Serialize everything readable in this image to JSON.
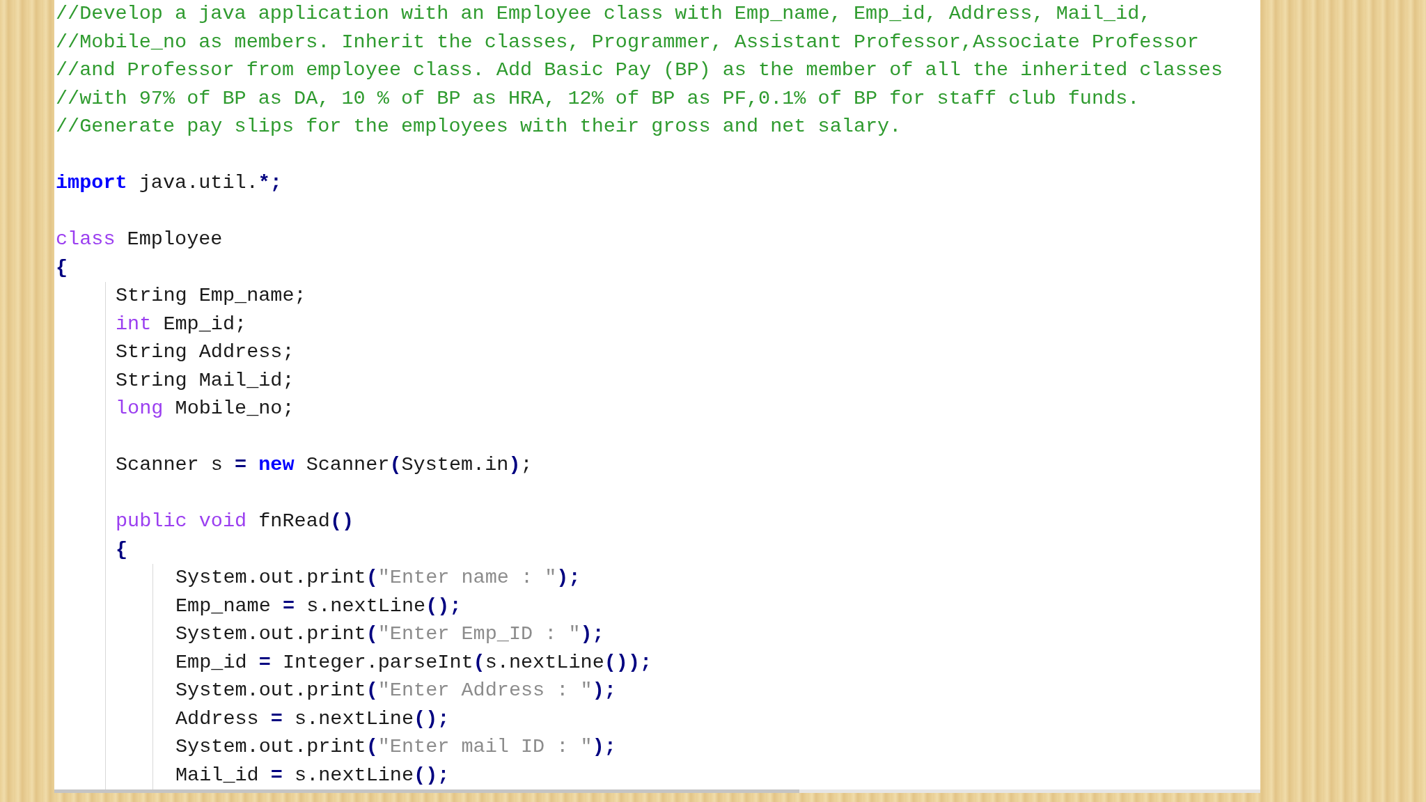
{
  "editor": {
    "lines": [
      {
        "kind": "code",
        "tokens": [
          {
            "kind": "comment",
            "text": "//Develop a java application with an Employee class with Emp_name, Emp_id, Address, Mail_id,"
          }
        ]
      },
      {
        "kind": "code",
        "tokens": [
          {
            "kind": "comment",
            "text": "//Mobile_no as members. Inherit the classes, Programmer, Assistant Professor,Associate Professor"
          }
        ]
      },
      {
        "kind": "code",
        "tokens": [
          {
            "kind": "comment",
            "text": "//and Professor from employee class. Add Basic Pay (BP) as the member of all the inherited classes"
          }
        ]
      },
      {
        "kind": "code",
        "tokens": [
          {
            "kind": "comment",
            "text": "//with 97% of BP as DA, 10 % of BP as HRA, 12% of BP as PF,0.1% of BP for staff club funds."
          }
        ]
      },
      {
        "kind": "code",
        "tokens": [
          {
            "kind": "comment",
            "text": "//Generate pay slips for the employees with their gross and net salary."
          }
        ]
      },
      {
        "kind": "blank"
      },
      {
        "kind": "code",
        "tokens": [
          {
            "kind": "keyword",
            "text": "import"
          },
          {
            "kind": "plain",
            "text": " java.util."
          },
          {
            "kind": "operator",
            "text": "*;"
          }
        ]
      },
      {
        "kind": "blank"
      },
      {
        "kind": "code",
        "tokens": [
          {
            "kind": "type",
            "text": "class"
          },
          {
            "kind": "plain",
            "text": " Employee"
          }
        ]
      },
      {
        "kind": "code",
        "tokens": [
          {
            "kind": "operator",
            "text": "{"
          }
        ],
        "children": [
          {
            "kind": "code",
            "tokens": [
              {
                "kind": "plain",
                "text": "String Emp_name;"
              }
            ]
          },
          {
            "kind": "code",
            "tokens": [
              {
                "kind": "type",
                "text": "int"
              },
              {
                "kind": "plain",
                "text": " Emp_id;"
              }
            ]
          },
          {
            "kind": "code",
            "tokens": [
              {
                "kind": "plain",
                "text": "String Address;"
              }
            ]
          },
          {
            "kind": "code",
            "tokens": [
              {
                "kind": "plain",
                "text": "String Mail_id;"
              }
            ]
          },
          {
            "kind": "code",
            "tokens": [
              {
                "kind": "type",
                "text": "long"
              },
              {
                "kind": "plain",
                "text": " Mobile_no;"
              }
            ]
          },
          {
            "kind": "blank"
          },
          {
            "kind": "code",
            "tokens": [
              {
                "kind": "plain",
                "text": "Scanner s "
              },
              {
                "kind": "operator",
                "text": "= "
              },
              {
                "kind": "keyword",
                "text": "new"
              },
              {
                "kind": "plain",
                "text": " Scanner"
              },
              {
                "kind": "operator",
                "text": "("
              },
              {
                "kind": "plain",
                "text": "System.in"
              },
              {
                "kind": "operator",
                "text": ")"
              },
              {
                "kind": "plain",
                "text": ";"
              }
            ]
          },
          {
            "kind": "blank"
          },
          {
            "kind": "code",
            "tokens": [
              {
                "kind": "type",
                "text": "public void"
              },
              {
                "kind": "plain",
                "text": " fnRead"
              },
              {
                "kind": "operator",
                "text": "()"
              }
            ]
          },
          {
            "kind": "code",
            "tokens": [
              {
                "kind": "operator",
                "text": "{"
              }
            ],
            "children": [
              {
                "kind": "code",
                "tokens": [
                  {
                    "kind": "plain",
                    "text": "System.out.print"
                  },
                  {
                    "kind": "operator",
                    "text": "("
                  },
                  {
                    "kind": "string",
                    "text": "\"Enter name : \""
                  },
                  {
                    "kind": "operator",
                    "text": ");"
                  }
                ]
              },
              {
                "kind": "code",
                "tokens": [
                  {
                    "kind": "plain",
                    "text": "Emp_name "
                  },
                  {
                    "kind": "operator",
                    "text": "="
                  },
                  {
                    "kind": "plain",
                    "text": " s.nextLine"
                  },
                  {
                    "kind": "operator",
                    "text": "();"
                  }
                ]
              },
              {
                "kind": "code",
                "tokens": [
                  {
                    "kind": "plain",
                    "text": "System.out.print"
                  },
                  {
                    "kind": "operator",
                    "text": "("
                  },
                  {
                    "kind": "string",
                    "text": "\"Enter Emp_ID : \""
                  },
                  {
                    "kind": "operator",
                    "text": ");"
                  }
                ]
              },
              {
                "kind": "code",
                "tokens": [
                  {
                    "kind": "plain",
                    "text": "Emp_id "
                  },
                  {
                    "kind": "operator",
                    "text": "="
                  },
                  {
                    "kind": "plain",
                    "text": " Integer.parseInt"
                  },
                  {
                    "kind": "operator",
                    "text": "("
                  },
                  {
                    "kind": "plain",
                    "text": "s.nextLine"
                  },
                  {
                    "kind": "operator",
                    "text": "());"
                  }
                ]
              },
              {
                "kind": "code",
                "tokens": [
                  {
                    "kind": "plain",
                    "text": "System.out.print"
                  },
                  {
                    "kind": "operator",
                    "text": "("
                  },
                  {
                    "kind": "string",
                    "text": "\"Enter Address : \""
                  },
                  {
                    "kind": "operator",
                    "text": ");"
                  }
                ]
              },
              {
                "kind": "code",
                "tokens": [
                  {
                    "kind": "plain",
                    "text": "Address "
                  },
                  {
                    "kind": "operator",
                    "text": "="
                  },
                  {
                    "kind": "plain",
                    "text": " s.nextLine"
                  },
                  {
                    "kind": "operator",
                    "text": "();"
                  }
                ]
              },
              {
                "kind": "code",
                "tokens": [
                  {
                    "kind": "plain",
                    "text": "System.out.print"
                  },
                  {
                    "kind": "operator",
                    "text": "("
                  },
                  {
                    "kind": "string",
                    "text": "\"Enter mail ID : \""
                  },
                  {
                    "kind": "operator",
                    "text": ");"
                  }
                ]
              },
              {
                "kind": "code",
                "tokens": [
                  {
                    "kind": "plain",
                    "text": "Mail_id "
                  },
                  {
                    "kind": "operator",
                    "text": "="
                  },
                  {
                    "kind": "plain",
                    "text": " s.nextLine"
                  },
                  {
                    "kind": "operator",
                    "text": "();"
                  }
                ]
              }
            ]
          }
        ]
      }
    ]
  }
}
